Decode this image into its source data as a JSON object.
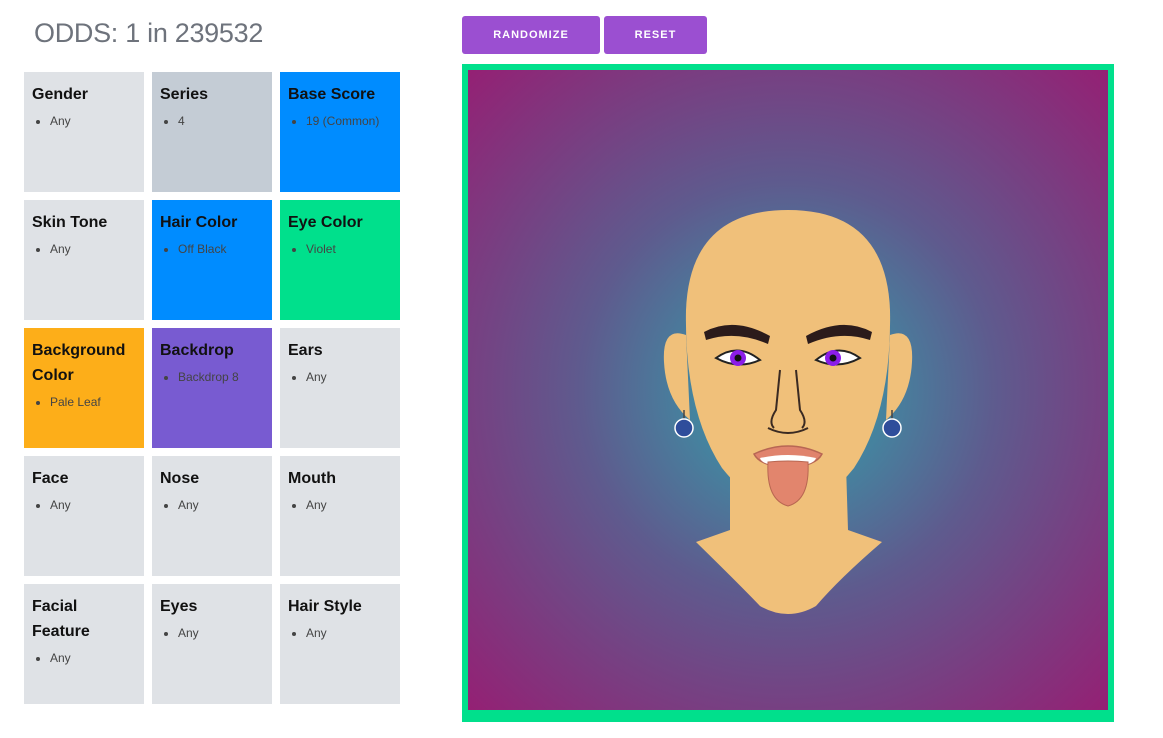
{
  "odds": "ODDS: 1 in 239532",
  "buttons": {
    "randomize": "RANDOMIZE",
    "reset": "RESET"
  },
  "colors": {
    "grey": "#dfe2e6",
    "grey_dark": "#c4ccd5",
    "blue": "#008cff",
    "green": "#00e08c",
    "orange": "#fdae19",
    "purple": "#785bd1",
    "button": "#9b4fd1",
    "frame": "#00e08c"
  },
  "traits": [
    {
      "title": "Gender",
      "value": "Any",
      "color": "grey"
    },
    {
      "title": "Series",
      "value": "4",
      "color": "grey_dark"
    },
    {
      "title": "Base Score",
      "value": "19 (Common)",
      "color": "blue"
    },
    {
      "title": "Skin Tone",
      "value": "Any",
      "color": "grey"
    },
    {
      "title": "Hair Color",
      "value": "Off Black",
      "color": "blue"
    },
    {
      "title": "Eye Color",
      "value": "Violet",
      "color": "green"
    },
    {
      "title": "Background Color",
      "value": "Pale Leaf",
      "color": "orange"
    },
    {
      "title": "Backdrop",
      "value": "Backdrop 8",
      "color": "purple"
    },
    {
      "title": "Ears",
      "value": "Any",
      "color": "grey"
    },
    {
      "title": "Face",
      "value": "Any",
      "color": "grey"
    },
    {
      "title": "Nose",
      "value": "Any",
      "color": "grey"
    },
    {
      "title": "Mouth",
      "value": "Any",
      "color": "grey"
    },
    {
      "title": "Facial Feature",
      "value": "Any",
      "color": "grey"
    },
    {
      "title": "Eyes",
      "value": "Any",
      "color": "grey"
    },
    {
      "title": "Hair Style",
      "value": "Any",
      "color": "grey"
    }
  ]
}
